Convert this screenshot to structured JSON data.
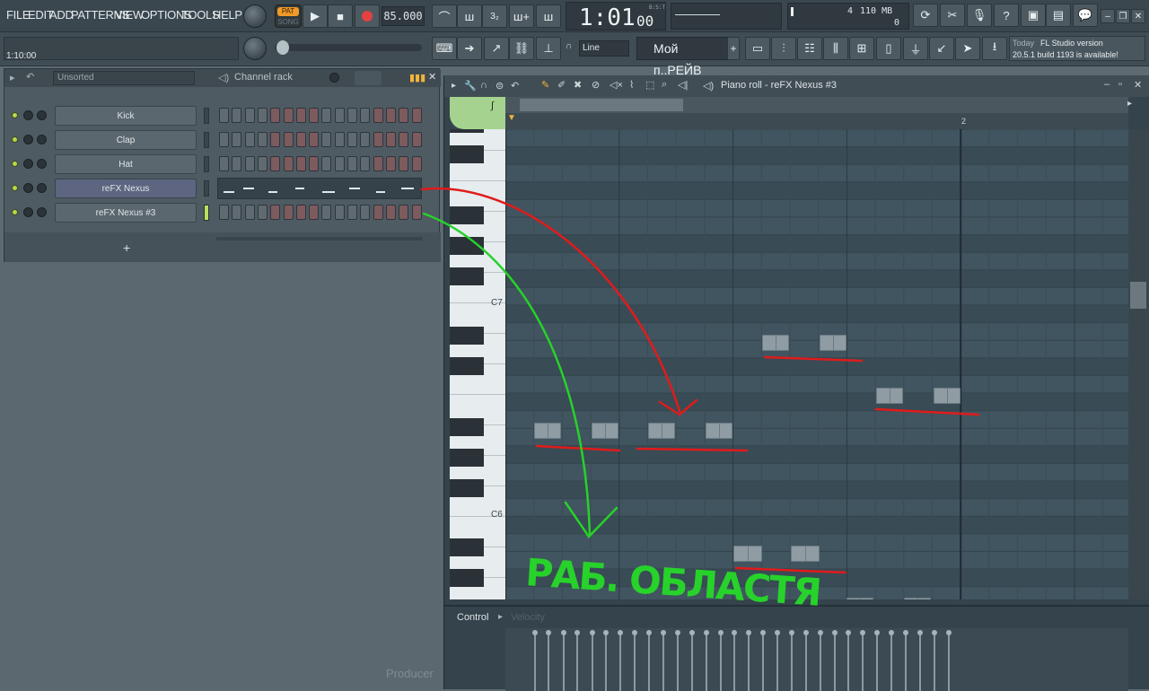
{
  "menu": [
    "FILE",
    "EDIT",
    "ADD",
    "PATTERNS",
    "VIEW",
    "OPTIONS",
    "TOOLS",
    "HELP"
  ],
  "transport": {
    "pat_label": "PAT",
    "song_label": "SONG",
    "tempo": "85.000",
    "time": "1:01",
    "time_sub": "00",
    "time_unit": "B:S:T",
    "pattern_pos": "1:10:00"
  },
  "monitor": {
    "value1": "4",
    "memory": "110 MB",
    "value2": "0"
  },
  "toolbar2": {
    "snap_mode": "Line",
    "pattern_name": "Мой п..РЕЙВ"
  },
  "news": {
    "line1_prefix": "Today",
    "line1": "FL Studio version",
    "line2": "20.5.1 build 1193 is available!"
  },
  "rack": {
    "filter": "Unsorted",
    "title": "Channel rack",
    "channels": [
      {
        "name": "Kick"
      },
      {
        "name": "Clap"
      },
      {
        "name": "Hat"
      },
      {
        "name": "reFX Nexus"
      },
      {
        "name": "reFX Nexus #3"
      }
    ],
    "add_label": "+"
  },
  "pianoroll": {
    "title": "Piano roll - reFX Nexus #3",
    "bar2_label": "2",
    "c7_label": "C7",
    "c6_label": "C6",
    "control_label": "Control",
    "control_param": "Velocity"
  },
  "browser": {
    "label": "Producer"
  },
  "annotation": {
    "text": "РАБ. ОБЛАСТЯ",
    "colors": {
      "red": "#e11b1b",
      "green": "#2bd62b"
    }
  }
}
